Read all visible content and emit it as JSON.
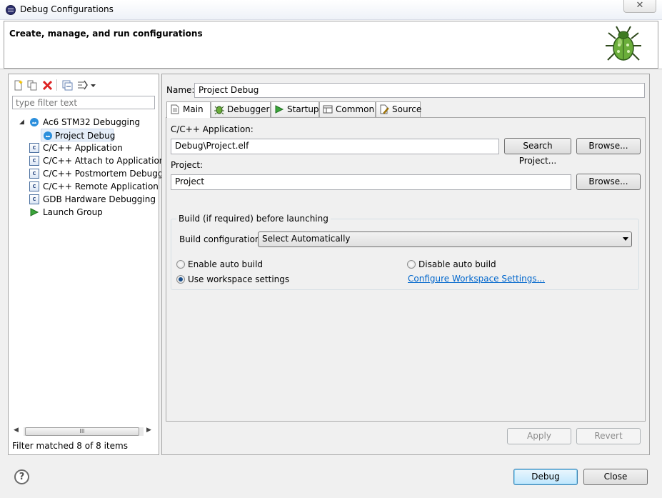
{
  "window": {
    "title": "Debug Configurations",
    "close_glyph": "✕"
  },
  "header": {
    "title": "Create, manage, and run configurations",
    "icon": "debug-bug-icon"
  },
  "left": {
    "filter_placeholder": "type filter text",
    "tree": [
      {
        "label": "Ac6 STM32 Debugging",
        "icon": "ac6-icon",
        "level": 0,
        "expanded": true
      },
      {
        "label": "Project Debug",
        "icon": "ac6-icon",
        "level": 1,
        "selected": true
      },
      {
        "label": "C/C++ Application",
        "icon": "c-icon",
        "level": 0
      },
      {
        "label": "C/C++ Attach to Application",
        "icon": "c-icon",
        "level": 0
      },
      {
        "label": "C/C++ Postmortem Debugge",
        "icon": "c-icon",
        "level": 0
      },
      {
        "label": "C/C++ Remote Application",
        "icon": "c-icon",
        "level": 0
      },
      {
        "label": "GDB Hardware Debugging",
        "icon": "c-icon",
        "level": 0
      },
      {
        "label": "Launch Group",
        "icon": "launch-group-icon",
        "level": 0
      }
    ],
    "scroll_thumb_glyph": "III",
    "status": "Filter matched 8 of 8 items"
  },
  "right": {
    "name_label": "Name:",
    "name_value": "Project Debug",
    "tabs": [
      {
        "label": "Main",
        "icon": "main-tab-icon",
        "active": true
      },
      {
        "label": "Debugger",
        "icon": "debugger-tab-icon"
      },
      {
        "label": "Startup",
        "icon": "startup-tab-icon"
      },
      {
        "label": "Common",
        "icon": "common-tab-icon"
      },
      {
        "label": "Source",
        "icon": "source-tab-icon"
      }
    ],
    "main": {
      "app_label": "C/C++ Application:",
      "app_value": "Debug\\Project.elf",
      "search_project": "Search Project...",
      "browse_app": "Browse...",
      "project_label": "Project:",
      "project_value": "Project",
      "browse_project": "Browse...",
      "build_group_title": "Build (if required) before launching",
      "build_config_label": "Build configuration:",
      "build_config_value": "Select Automatically",
      "radio_enable": "Enable auto build",
      "radio_disable": "Disable auto build",
      "radio_workspace": "Use workspace settings",
      "radio_selected": "Use workspace settings",
      "configure_link": "Configure Workspace Settings..."
    },
    "apply": "Apply",
    "revert": "Revert"
  },
  "footer": {
    "help": "?",
    "debug": "Debug",
    "close": "Close"
  },
  "colors": {
    "link": "#0066cc",
    "selection": "#e5eef9",
    "default_button": "#bee6fd"
  }
}
